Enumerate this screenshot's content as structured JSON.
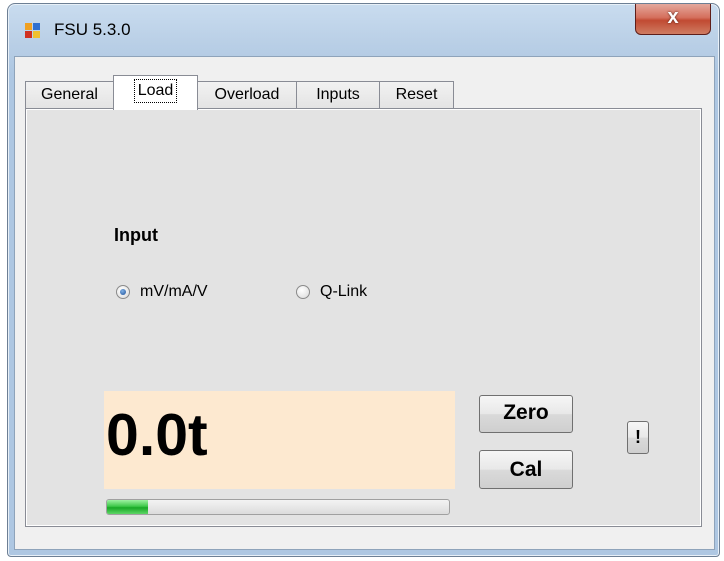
{
  "window": {
    "title": "FSU 5.3.0",
    "close_label": "x"
  },
  "tabs": [
    {
      "label": "General",
      "selected": false
    },
    {
      "label": "Load",
      "selected": true
    },
    {
      "label": "Overload",
      "selected": false
    },
    {
      "label": "Inputs",
      "selected": false
    },
    {
      "label": "Reset",
      "selected": false
    }
  ],
  "load": {
    "input_heading": "Input",
    "input_options": [
      {
        "label": "mV/mA/V",
        "checked": true
      },
      {
        "label": "Q-Link",
        "checked": false
      }
    ],
    "display_value": "0.0t",
    "display_background": "#fde9d0",
    "zero_label": "Zero",
    "cal_label": "Cal",
    "alert_label": "!",
    "progress_fraction": 0.12,
    "progress_color": "#2fbf3c"
  }
}
